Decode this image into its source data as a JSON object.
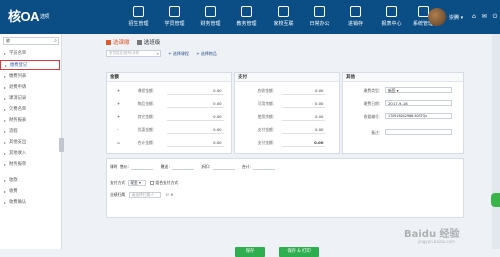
{
  "logo": {
    "main": "核",
    "oa": "OA",
    "sub": "选项"
  },
  "nav": [
    {
      "label": "招生管理",
      "icon": "users-icon"
    },
    {
      "label": "学员管理",
      "icon": "student-icon"
    },
    {
      "label": "财务管理",
      "icon": "finance-icon"
    },
    {
      "label": "教务管理",
      "icon": "calendar-icon"
    },
    {
      "label": "家校互联",
      "icon": "home-icon"
    },
    {
      "label": "日常办公",
      "icon": "briefcase-icon"
    },
    {
      "label": "进销存",
      "icon": "box-icon"
    },
    {
      "label": "报表中心",
      "icon": "chart-icon"
    },
    {
      "label": "系统管理",
      "icon": "gear-icon"
    }
  ],
  "user": {
    "name": "崇腾 ▾",
    "icons": "⌂ ✉ ⏻"
  },
  "sidebar": {
    "search_value": "收",
    "items": [
      "学员名单",
      "缴费登记",
      "缴费列表",
      "退费申请",
      "课消记录",
      "欠费名单",
      "财务报表",
      "流程",
      "其他支出",
      "其他收入",
      "财务报单",
      "收款",
      "收费",
      "收费确认"
    ],
    "active_index": 1
  },
  "tabs": [
    {
      "label": "选课缴"
    },
    {
      "label": "选班级"
    }
  ],
  "actions": {
    "search_placeholder": "学员姓名/账号/手机",
    "add_course": "+ 选择课程",
    "add_item": "+ 选择物品"
  },
  "amount": {
    "title": "金额",
    "rows": [
      {
        "op": "+",
        "label": "课程金额：",
        "value": "0.00"
      },
      {
        "op": "+",
        "label": "物品金额：",
        "value": "0.00"
      },
      {
        "op": "+",
        "label": "其它金额：",
        "value": "0.00"
      },
      {
        "op": "-",
        "label": "优惠金额：",
        "value": "0.00"
      },
      {
        "op": "=",
        "label": "合计金额：",
        "value": "0.00"
      }
    ]
  },
  "pay": {
    "title": "支付",
    "rows": [
      {
        "label": "应收金额：",
        "value": "0.00"
      },
      {
        "label": "可用余额：",
        "value": "0.00"
      },
      {
        "label": "使用余额：",
        "value": "0.00"
      },
      {
        "label": "支付金额：",
        "value": "0.00"
      },
      {
        "label": "支付金额：",
        "value": "0.00"
      }
    ]
  },
  "other": {
    "title": "其他",
    "rows": [
      {
        "label": "缴费类型：",
        "value": "新签 ▾"
      },
      {
        "label": "缴费日期：",
        "value": "2017-9-18"
      },
      {
        "label": "收据编号：",
        "value": "170918042966-903TQu"
      },
      {
        "label": "备注：",
        "value": ""
      }
    ]
  },
  "bottom": {
    "row1": {
      "a": "课时",
      "b": "售价：",
      "c": "赠送：",
      "d": "折扣：",
      "e": "合计："
    },
    "pay_method_label": "支付方式",
    "pay_method_value": "现金 ▾",
    "pay_other": "组合支付方式",
    "sales_label": "业绩归属",
    "sales_placeholder": "请选择归属人"
  },
  "buttons": {
    "save": "保存",
    "save_print": "保存 & 打印"
  },
  "watermark": {
    "main": "Baidu 经验",
    "sub": "jingyan.baidu.com"
  }
}
